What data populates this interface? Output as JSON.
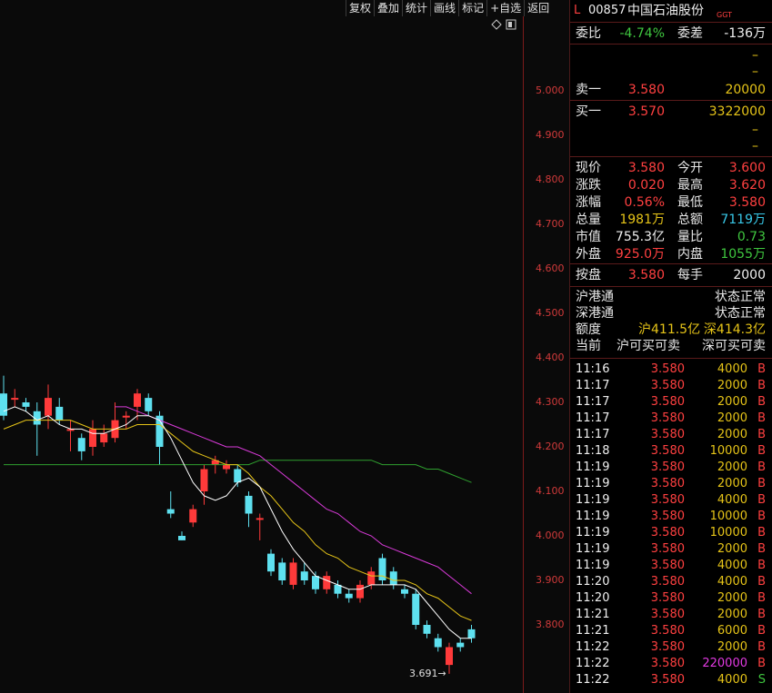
{
  "toolbar": [
    "复权",
    "叠加",
    "统计",
    "画线",
    "标记",
    "+自选",
    "返回"
  ],
  "colors": {
    "up": "#ff3a3a",
    "down": "#5ee0ef",
    "ma5": "#ffffff",
    "ma10": "#e6c418",
    "ma20": "#d83ad8",
    "ma60": "#2fa02f",
    "axis": "#d03a3a"
  },
  "price_axis": [
    "5.000",
    "4.900",
    "4.800",
    "4.700",
    "4.600",
    "4.500",
    "4.400",
    "4.300",
    "4.200",
    "4.100",
    "4.000",
    "3.900",
    "3.800"
  ],
  "low_marker": "3.691",
  "header": {
    "market": "L",
    "code": "00857",
    "name": "中国石油股份",
    "tag": "GGT"
  },
  "weibi": {
    "label": "委比",
    "value": "-4.74%",
    "diff_label": "委差",
    "diff_value": "-136万"
  },
  "sell_dashes": [
    "–",
    "–"
  ],
  "sell1": {
    "label": "卖一",
    "price": "3.580",
    "volume": "20000"
  },
  "buy1": {
    "label": "买一",
    "price": "3.570",
    "volume": "3322000"
  },
  "buy_dashes": [
    "–",
    "–"
  ],
  "stats": [
    {
      "l1": "现价",
      "v1": "3.580",
      "c1": "red",
      "l2": "今开",
      "v2": "3.600",
      "c2": "red"
    },
    {
      "l1": "涨跌",
      "v1": "0.020",
      "c1": "red",
      "l2": "最高",
      "v2": "3.620",
      "c2": "red"
    },
    {
      "l1": "涨幅",
      "v1": "0.56%",
      "c1": "red",
      "l2": "最低",
      "v2": "3.580",
      "c2": "red"
    },
    {
      "l1": "总量",
      "v1": "1981万",
      "c1": "yellow",
      "l2": "总额",
      "v2": "7119万",
      "c2": "cyan"
    },
    {
      "l1": "市值",
      "v1": "755.3亿",
      "c1": "white",
      "l2": "量比",
      "v2": "0.73",
      "c2": "green"
    },
    {
      "l1": "外盘",
      "v1": "925.0万",
      "c1": "red",
      "l2": "内盘",
      "v2": "1055万",
      "c2": "green"
    }
  ],
  "anpan": {
    "label": "按盘",
    "value": "3.580",
    "lot_label": "每手",
    "lot_value": "2000"
  },
  "connect": {
    "hk_sh": {
      "label": "沪港通",
      "value": "状态正常"
    },
    "hk_sz": {
      "label": "深港通",
      "value": "状态正常"
    },
    "quota": {
      "label": "额度",
      "sh": "沪411.5亿",
      "sz": "深414.3亿"
    },
    "current": {
      "label": "当前",
      "sh": "沪可买可卖",
      "sz": "深可买可卖"
    }
  },
  "ticks": [
    {
      "time": "11:16",
      "price": "3.580",
      "volume": "4000",
      "side": "B"
    },
    {
      "time": "11:17",
      "price": "3.580",
      "volume": "2000",
      "side": "B"
    },
    {
      "time": "11:17",
      "price": "3.580",
      "volume": "2000",
      "side": "B"
    },
    {
      "time": "11:17",
      "price": "3.580",
      "volume": "2000",
      "side": "B"
    },
    {
      "time": "11:17",
      "price": "3.580",
      "volume": "2000",
      "side": "B"
    },
    {
      "time": "11:18",
      "price": "3.580",
      "volume": "10000",
      "side": "B"
    },
    {
      "time": "11:19",
      "price": "3.580",
      "volume": "2000",
      "side": "B"
    },
    {
      "time": "11:19",
      "price": "3.580",
      "volume": "2000",
      "side": "B"
    },
    {
      "time": "11:19",
      "price": "3.580",
      "volume": "4000",
      "side": "B"
    },
    {
      "time": "11:19",
      "price": "3.580",
      "volume": "10000",
      "side": "B"
    },
    {
      "time": "11:19",
      "price": "3.580",
      "volume": "10000",
      "side": "B"
    },
    {
      "time": "11:19",
      "price": "3.580",
      "volume": "2000",
      "side": "B"
    },
    {
      "time": "11:19",
      "price": "3.580",
      "volume": "4000",
      "side": "B"
    },
    {
      "time": "11:20",
      "price": "3.580",
      "volume": "4000",
      "side": "B"
    },
    {
      "time": "11:20",
      "price": "3.580",
      "volume": "2000",
      "side": "B"
    },
    {
      "time": "11:21",
      "price": "3.580",
      "volume": "2000",
      "side": "B"
    },
    {
      "time": "11:21",
      "price": "3.580",
      "volume": "6000",
      "side": "B"
    },
    {
      "time": "11:22",
      "price": "3.580",
      "volume": "2000",
      "side": "B"
    },
    {
      "time": "11:22",
      "price": "3.580",
      "volume": "220000",
      "side": "B"
    },
    {
      "time": "11:22",
      "price": "3.580",
      "volume": "4000",
      "side": "S"
    }
  ],
  "chart_data": {
    "type": "candlestick",
    "ylim": [
      3.65,
      5.0
    ],
    "candles": [
      [
        4.32,
        4.27,
        4.36,
        4.26
      ],
      [
        4.31,
        4.31,
        4.33,
        4.29
      ],
      [
        4.3,
        4.29,
        4.31,
        4.28
      ],
      [
        4.28,
        4.25,
        4.3,
        4.18
      ],
      [
        4.27,
        4.31,
        4.34,
        4.24
      ],
      [
        4.29,
        4.26,
        4.31,
        4.25
      ],
      [
        4.24,
        4.24,
        4.26,
        4.19
      ],
      [
        4.22,
        4.19,
        4.23,
        4.17
      ],
      [
        4.2,
        4.24,
        4.26,
        4.18
      ],
      [
        4.21,
        4.23,
        4.25,
        4.2
      ],
      [
        4.22,
        4.26,
        4.3,
        4.21
      ],
      [
        4.27,
        4.27,
        4.28,
        4.24
      ],
      [
        4.29,
        4.32,
        4.33,
        4.26
      ],
      [
        4.31,
        4.28,
        4.32,
        4.27
      ],
      [
        4.27,
        4.2,
        4.28,
        4.16
      ],
      [
        4.06,
        4.05,
        4.1,
        4.04
      ],
      [
        4.0,
        3.99,
        4.01,
        3.99
      ],
      [
        4.03,
        4.06,
        4.07,
        4.02
      ],
      [
        4.1,
        4.15,
        4.16,
        4.07
      ],
      [
        4.16,
        4.17,
        4.18,
        4.14
      ],
      [
        4.15,
        4.16,
        4.17,
        4.14
      ],
      [
        4.15,
        4.12,
        4.16,
        4.11
      ],
      [
        4.09,
        4.05,
        4.1,
        4.02
      ],
      [
        4.04,
        4.04,
        4.05,
        3.99
      ],
      [
        3.96,
        3.92,
        3.97,
        3.91
      ],
      [
        3.94,
        3.9,
        3.95,
        3.89
      ],
      [
        3.89,
        3.94,
        3.95,
        3.88
      ],
      [
        3.92,
        3.9,
        3.94,
        3.89
      ],
      [
        3.91,
        3.88,
        3.92,
        3.87
      ],
      [
        3.88,
        3.91,
        3.92,
        3.87
      ],
      [
        3.89,
        3.87,
        3.9,
        3.86
      ],
      [
        3.87,
        3.86,
        3.88,
        3.85
      ],
      [
        3.86,
        3.89,
        3.9,
        3.85
      ],
      [
        3.89,
        3.92,
        3.93,
        3.88
      ],
      [
        3.95,
        3.9,
        3.96,
        3.89
      ],
      [
        3.92,
        3.89,
        3.93,
        3.88
      ],
      [
        3.88,
        3.87,
        3.89,
        3.86
      ],
      [
        3.87,
        3.8,
        3.88,
        3.79
      ],
      [
        3.8,
        3.78,
        3.81,
        3.77
      ],
      [
        3.77,
        3.75,
        3.78,
        3.74
      ],
      [
        3.71,
        3.75,
        3.76,
        3.69
      ],
      [
        3.76,
        3.75,
        3.77,
        3.74
      ],
      [
        3.79,
        3.77,
        3.8,
        3.76
      ]
    ],
    "ma5": [
      4.28,
      4.29,
      4.28,
      4.26,
      4.27,
      4.25,
      4.24,
      4.24,
      4.23,
      4.23,
      4.24,
      4.25,
      4.27,
      4.27,
      4.26,
      4.22,
      4.17,
      4.12,
      4.09,
      4.08,
      4.09,
      4.12,
      4.13,
      4.11,
      4.06,
      4.01,
      3.97,
      3.94,
      3.91,
      3.9,
      3.89,
      3.88,
      3.88,
      3.89,
      3.89,
      3.89,
      3.89,
      3.88,
      3.85,
      3.82,
      3.79,
      3.77,
      3.77
    ],
    "ma10": [
      4.24,
      4.25,
      4.26,
      4.26,
      4.26,
      4.26,
      4.26,
      4.25,
      4.24,
      4.24,
      4.24,
      4.24,
      4.25,
      4.25,
      4.25,
      4.23,
      4.21,
      4.19,
      4.18,
      4.17,
      4.16,
      4.16,
      4.14,
      4.11,
      4.09,
      4.06,
      4.03,
      4.01,
      3.98,
      3.96,
      3.95,
      3.93,
      3.92,
      3.91,
      3.91,
      3.9,
      3.9,
      3.89,
      3.87,
      3.86,
      3.84,
      3.82,
      3.81
    ],
    "ma20": [
      null,
      null,
      null,
      null,
      null,
      null,
      null,
      null,
      null,
      null,
      4.29,
      4.29,
      4.28,
      4.27,
      4.26,
      4.25,
      4.24,
      4.23,
      4.22,
      4.21,
      4.2,
      4.2,
      4.19,
      4.18,
      4.16,
      4.14,
      4.12,
      4.1,
      4.08,
      4.06,
      4.05,
      4.03,
      4.01,
      4.0,
      3.98,
      3.97,
      3.96,
      3.95,
      3.94,
      3.93,
      3.91,
      3.89,
      3.87
    ],
    "ma60": [
      4.16,
      4.16,
      4.16,
      4.16,
      4.16,
      4.16,
      4.16,
      4.16,
      4.16,
      4.16,
      4.16,
      4.16,
      4.16,
      4.16,
      4.16,
      4.16,
      4.16,
      4.16,
      4.16,
      4.16,
      4.16,
      4.16,
      4.16,
      4.17,
      4.17,
      4.17,
      4.17,
      4.17,
      4.17,
      4.17,
      4.17,
      4.17,
      4.17,
      4.17,
      4.16,
      4.16,
      4.16,
      4.16,
      4.15,
      4.15,
      4.14,
      4.13,
      4.12
    ]
  }
}
